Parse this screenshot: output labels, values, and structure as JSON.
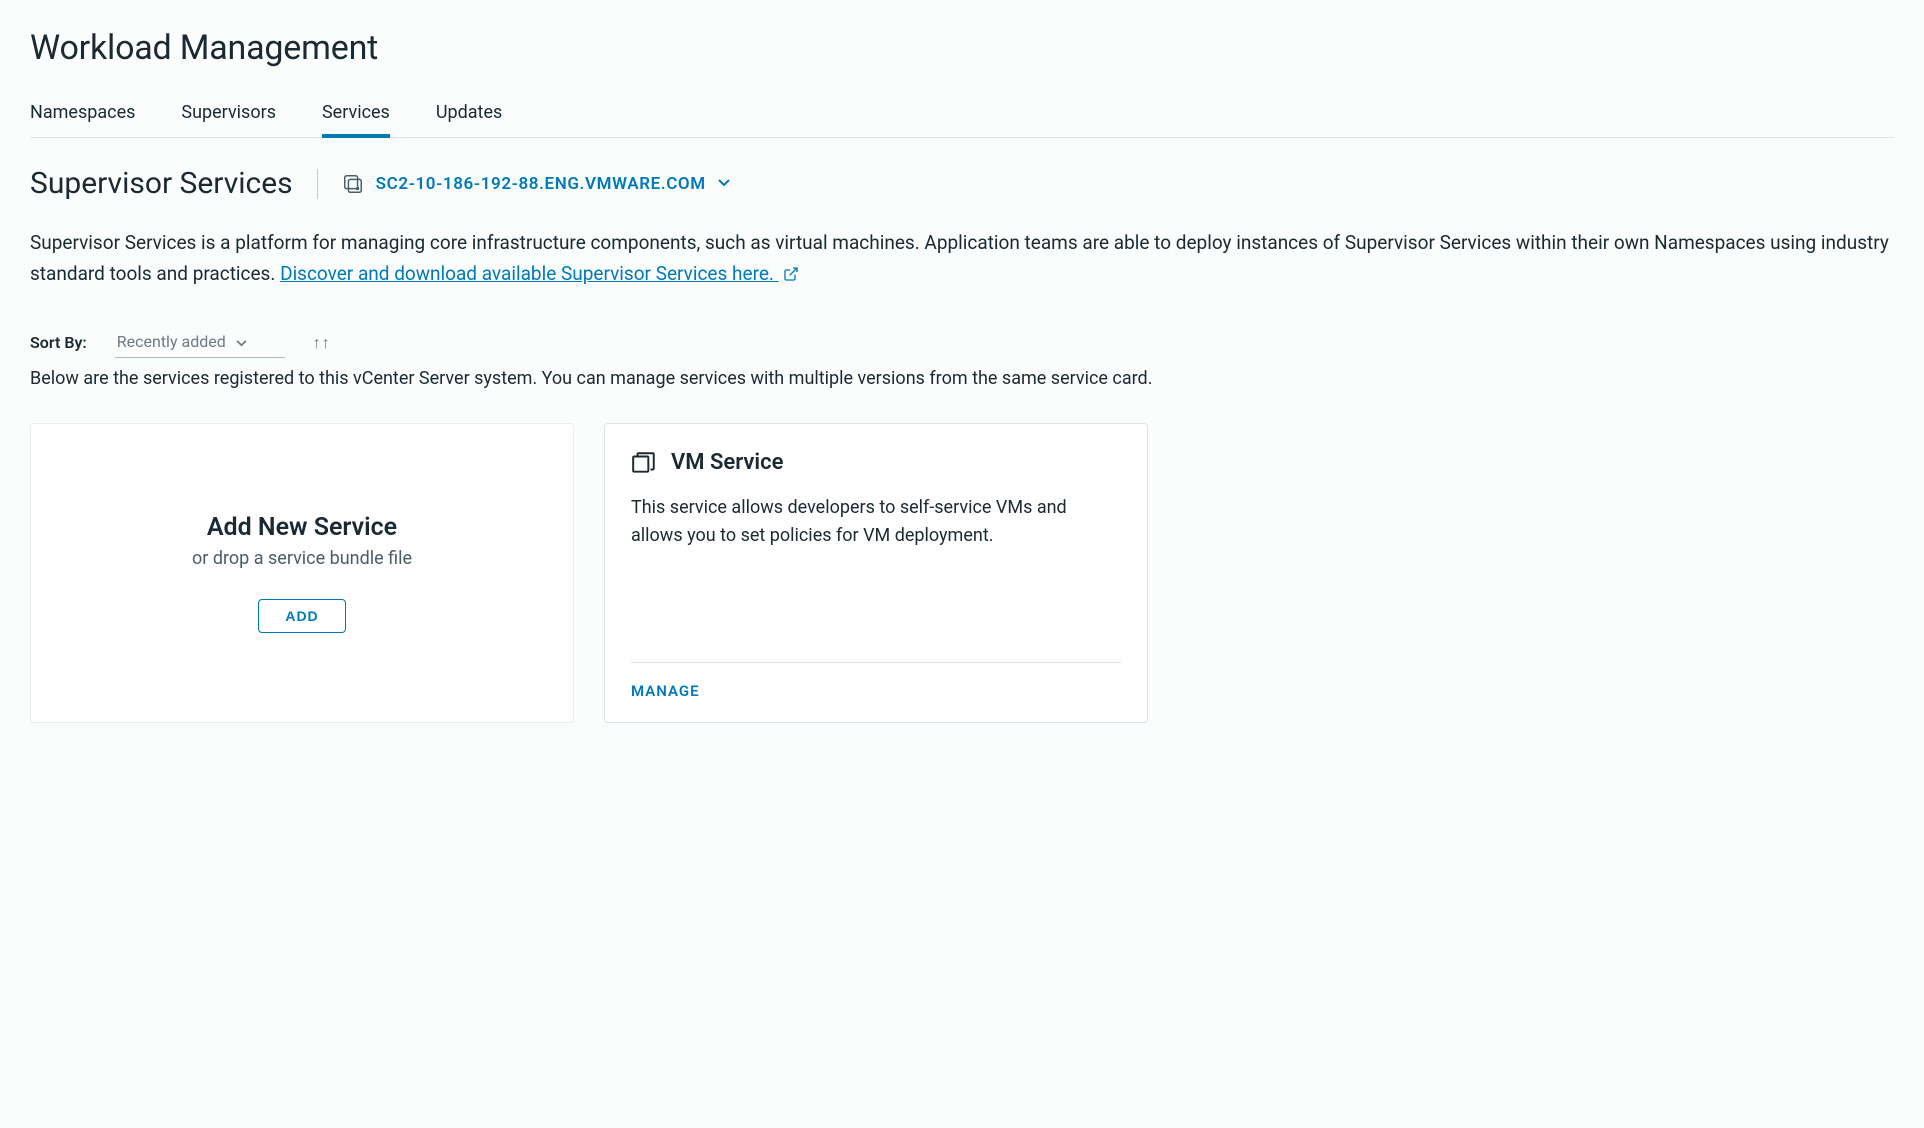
{
  "page_title": "Workload Management",
  "tabs": [
    "Namespaces",
    "Supervisors",
    "Services",
    "Updates"
  ],
  "active_tab_index": 2,
  "subheader": {
    "title": "Supervisor Services",
    "vcenter_label": "SC2-10-186-192-88.ENG.VMWARE.COM"
  },
  "description": {
    "text": "Supervisor Services is a platform for managing core infrastructure components, such as virtual machines. Application teams are able to deploy instances of Supervisor Services within their own Namespaces using industry standard tools and practices.  ",
    "link_text": "Discover and download available Supervisor Services here. "
  },
  "sort": {
    "label": "Sort By:",
    "value": "Recently added"
  },
  "list_note": "Below are the services registered to this vCenter Server system. You can manage services with multiple versions from the same service card.",
  "add_card": {
    "title": "Add New Service",
    "subtitle": "or drop a service bundle file",
    "button": "ADD"
  },
  "services": [
    {
      "name": "VM Service",
      "description": "This service allows developers to self-service VMs and allows you to set policies for VM deployment.",
      "action": "MANAGE"
    }
  ]
}
